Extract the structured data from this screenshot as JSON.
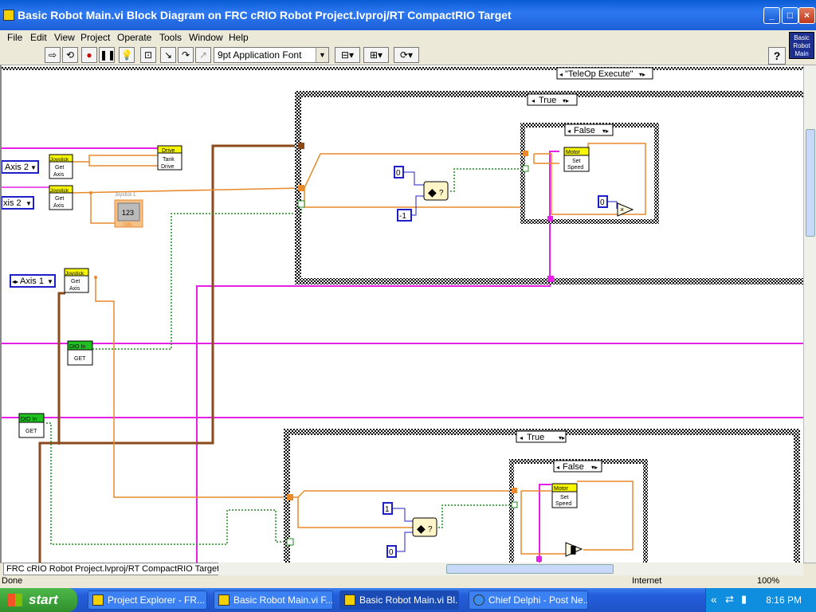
{
  "window": {
    "title": "Basic Robot Main.vi Block Diagram on FRC cRIO Robot Project.lvproj/RT CompactRIO Target"
  },
  "menu": [
    "File",
    "Edit",
    "View",
    "Project",
    "Operate",
    "Tools",
    "Window",
    "Help"
  ],
  "toolbar": {
    "font_label": "9pt Application Font",
    "help_label": "?"
  },
  "vi_icon_text": [
    "Basic",
    "Robot",
    "Main"
  ],
  "diagram": {
    "case_selector": "\"TeleOp Execute\"",
    "upper_case_label": "True",
    "upper_inner_case_label": "False",
    "lower_case_label": "True",
    "lower_inner_case_label": "False",
    "drive_block": {
      "header": "Drive",
      "line1": "Tank",
      "line2": "Drive"
    },
    "joystick_label": "Joystick",
    "get_axis_line1": "Get",
    "get_axis_line2": "Axis",
    "axis_labels": [
      "Axis 2",
      "xis 2",
      "Axis 1"
    ],
    "joystick_indicator": {
      "caption": "Joystick 1",
      "value": "123",
      "type": "DBL"
    },
    "dio_in_label": "DIO In",
    "dio_get_label": "GET",
    "motor_label": "Motor",
    "set_speed_line1": "Set",
    "set_speed_line2": "Speed",
    "constants_upper": [
      "0",
      "-1",
      "0"
    ],
    "constants_lower": [
      "1",
      "0"
    ],
    "select_symbol": "?"
  },
  "context_path": "FRC cRIO Robot Project.lvproj/RT CompactRIO Target",
  "statusbar": {
    "left": "Done",
    "middle": "Internet",
    "right": "100%"
  },
  "taskbar": {
    "start_label": "start",
    "tasks": [
      "Project Explorer - FR...",
      "Basic Robot Main.vi F...",
      "Basic Robot Main.vi Bl...",
      "Chief Delphi - Post Ne..."
    ],
    "clock": "8:16 PM"
  },
  "colors": {
    "orange_wire": "#e8892c",
    "pink_wire": "#e620e6",
    "brown_wire": "#8a4a1c",
    "green_wire": "#1f8a1f",
    "numeric_blue": "#2020c8",
    "joystick_yellow": "#f7f700",
    "dio_green": "#20c020",
    "xp_blue": "#0a5bd6"
  }
}
